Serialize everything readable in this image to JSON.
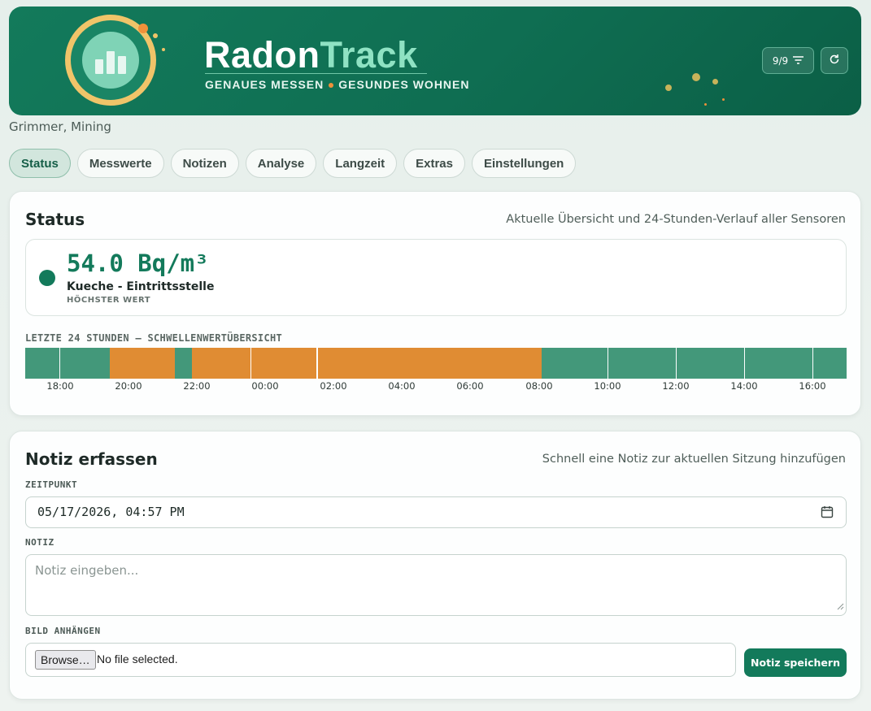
{
  "header": {
    "brand_main": "Radon",
    "brand_accent": "Track",
    "tagline_left": "GENAUES MESSEN",
    "tagline_right": "GESUNDES WOHNEN",
    "filter_label": "9/9",
    "filter_icon": "filter-lines-icon",
    "refresh_icon": "refresh-icon",
    "logo_icon": "bar-chart-logo-icon"
  },
  "subtitle": "Grimmer, Mining",
  "tabs": [
    {
      "label": "Status",
      "active": true
    },
    {
      "label": "Messwerte",
      "active": false
    },
    {
      "label": "Notizen",
      "active": false
    },
    {
      "label": "Analyse",
      "active": false
    },
    {
      "label": "Langzeit",
      "active": false
    },
    {
      "label": "Extras",
      "active": false
    },
    {
      "label": "Einstellungen",
      "active": false
    }
  ],
  "status": {
    "title": "Status",
    "description": "Aktuelle Übersicht und 24-Stunden-Verlauf aller Sensoren",
    "value": "54.0 Bq/m³",
    "location": "Kueche - Eintrittsstelle",
    "caption": "HÖCHSTER WERT",
    "timeline_label": "LETZTE 24 STUNDEN – SCHWELLENWERTÜBERSICHT",
    "ticks": [
      "18:00",
      "20:00",
      "22:00",
      "00:00",
      "02:00",
      "04:00",
      "06:00",
      "08:00",
      "10:00",
      "12:00",
      "14:00",
      "16:00"
    ]
  },
  "colors": {
    "brand": "#137a5b",
    "ok": "#43987a",
    "warn": "#e08c33",
    "accent_orange": "#f0913a",
    "ring": "#f0c469"
  },
  "note": {
    "title": "Notiz erfassen",
    "description": "Schnell eine Notiz zur aktuellen Sitzung hinzufügen",
    "time_label": "ZEITPUNKT",
    "time_value": "05/17/2026, 04:57 PM",
    "calendar_icon": "calendar-icon",
    "note_label": "NOTIZ",
    "note_placeholder": "Notiz eingeben...",
    "attach_label": "BILD ANHÄNGEN",
    "browse_label": "Browse…",
    "file_status": "No file selected.",
    "save_label": "Notiz speichern"
  }
}
